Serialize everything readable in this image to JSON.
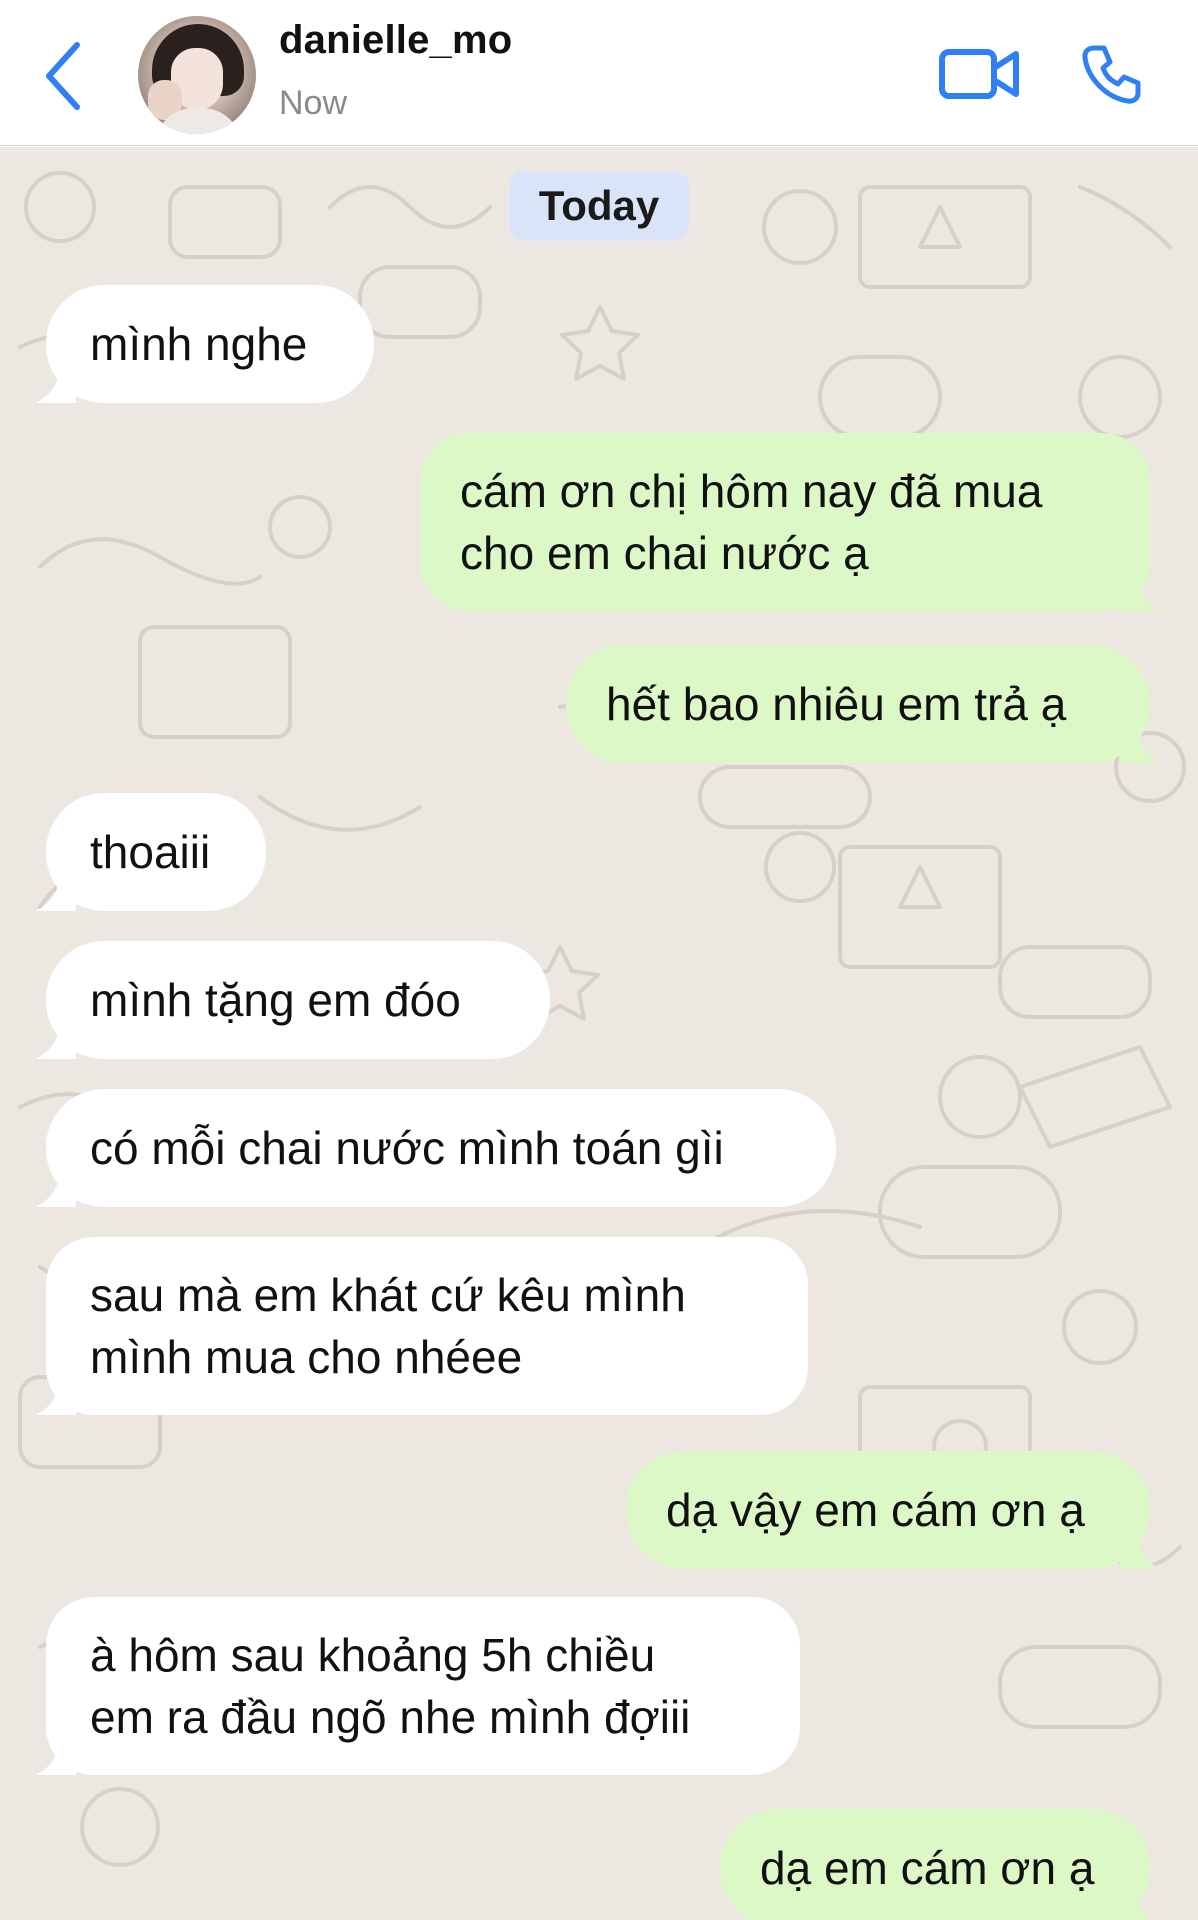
{
  "header": {
    "contact_name": "danielle_mo",
    "status": "Now",
    "back_icon": "chevron-left-icon",
    "video_icon": "video-camera-icon",
    "call_icon": "phone-icon",
    "accent_color": "#2f7ff5"
  },
  "chat": {
    "date_label": "Today",
    "incoming_color": "#ffffff",
    "outgoing_color": "#dcf8c6",
    "messages": [
      {
        "dir": "in",
        "lines": [
          "mình nghe"
        ]
      },
      {
        "dir": "out",
        "lines": [
          "cám ơn chị hôm nay đã mua",
          "cho em chai nước ạ"
        ]
      },
      {
        "dir": "out",
        "lines": [
          "hết bao nhiêu em trả ạ"
        ]
      },
      {
        "dir": "in",
        "lines": [
          "thoaiii"
        ]
      },
      {
        "dir": "in",
        "lines": [
          "mình tặng em đóo"
        ]
      },
      {
        "dir": "in",
        "lines": [
          "có mỗi chai nước mình toán gìi"
        ]
      },
      {
        "dir": "in",
        "lines": [
          "sau mà em khát cứ kêu mình",
          "mình mua cho nhéee"
        ]
      },
      {
        "dir": "out",
        "lines": [
          "dạ vậy em cám ơn ạ"
        ]
      },
      {
        "dir": "in",
        "lines": [
          "à hôm sau khoảng 5h chiều",
          "em ra đầu ngõ nhe mình đợiii"
        ]
      },
      {
        "dir": "out",
        "lines": [
          "dạ em cám ơn ạ"
        ]
      }
    ]
  }
}
